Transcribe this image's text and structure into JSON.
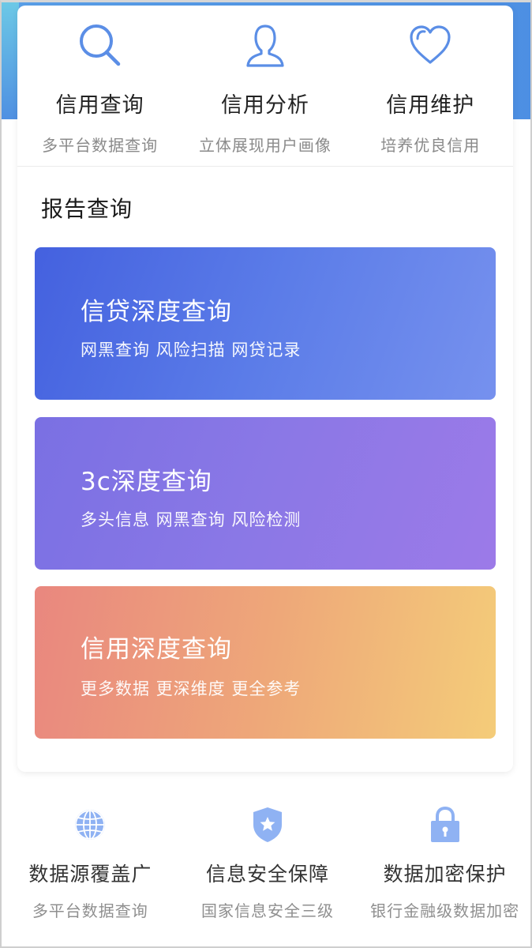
{
  "features": [
    {
      "icon": "search-icon",
      "title": "信用查询",
      "sub": "多平台数据查询"
    },
    {
      "icon": "user-icon",
      "title": "信用分析",
      "sub": "立体展现用户画像"
    },
    {
      "icon": "heart-icon",
      "title": "信用维护",
      "sub": "培养优良信用"
    }
  ],
  "section_title": "报告查询",
  "reports": [
    {
      "title": "信贷深度查询",
      "sub": "网黑查询 风险扫描 网贷记录"
    },
    {
      "title": "3c深度查询",
      "sub": "多头信息 网黑查询 风险检测"
    },
    {
      "title": "信用深度查询",
      "sub": "更多数据 更深维度 更全参考"
    }
  ],
  "guarantees": [
    {
      "icon": "globe-icon",
      "title": "数据源覆盖广",
      "sub": "多平台数据查询"
    },
    {
      "icon": "shield-star-icon",
      "title": "信息安全保障",
      "sub": "国家信息安全三级"
    },
    {
      "icon": "lock-icon",
      "title": "数据加密保护",
      "sub": "银行金融级数据加密"
    }
  ],
  "colors": {
    "accent_blue": "#5b8ee6",
    "icon_light_blue": "#8fb2f3",
    "report1": "#4461df",
    "report2": "#8b78e6",
    "report3": "#eea779"
  }
}
